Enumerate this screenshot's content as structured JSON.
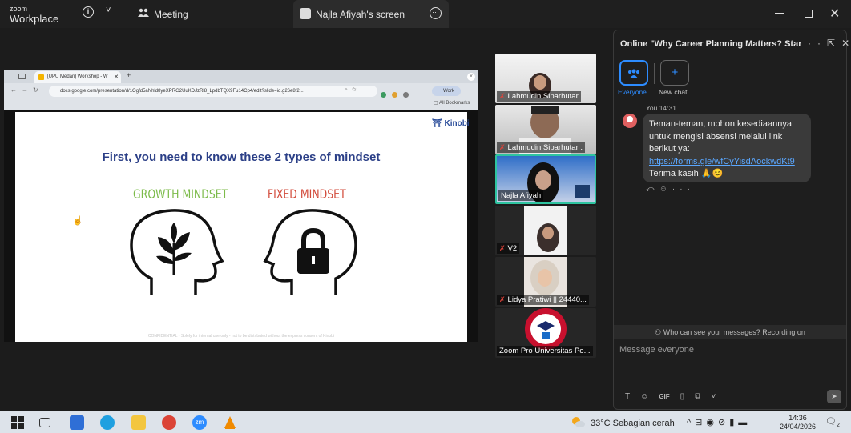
{
  "app": {
    "logo_line1": "zoom",
    "logo_line2": "Workplace",
    "info_icon": "info-icon",
    "chevron": "˅"
  },
  "toolbar": {
    "meeting_label": "Meeting",
    "share_label": "Najla Afiyah's screen"
  },
  "browser": {
    "tab_title": "[UPU Medan] Workshop - W",
    "url": "docs.google.com/presentation/d/1Ogfd5aNhld8yeXPRG2UuKDJzRl8_LpdbTQX9Fu14Cp4/edit?slide=id.g26e8f2...",
    "profile_label": "Work",
    "bookmarks_label": "All Bookmarks"
  },
  "slide": {
    "brand": "Kinobi",
    "title": "First, you need to know these 2 types of mindset",
    "growth_label": "GROWTH MINDSET",
    "fixed_label": "FIXED MINDSET",
    "footer": "CONFIDENTIAL - Solely for internal use only - not to be distributed without the express consent of Kinobi"
  },
  "gallery": {
    "tiles": [
      {
        "name": "Lahmudin Siparhutar",
        "muted": true
      },
      {
        "name": "Lahmudin Siparhutar .",
        "muted": true
      },
      {
        "name": "Najla Afiyah",
        "muted": false
      },
      {
        "name": "V2",
        "muted": true
      },
      {
        "name": "Lidya Pratiwi || 24440...",
        "muted": true
      },
      {
        "name": "Zoom Pro Universitas Po...",
        "muted": false
      }
    ]
  },
  "chat": {
    "title": "Online \"Why Career Planning Matters? Star...",
    "targets": [
      {
        "label": "Everyone"
      },
      {
        "label": "New chat"
      }
    ],
    "message": {
      "sender_meta": "You 14:31",
      "lines": [
        "Teman-teman, mohon kesediaannya",
        "untuk mengisi absensi melalui link",
        "berikut ya:"
      ],
      "link": "https://forms.gle/wfCyYisdAockwdKt9",
      "closing": "Terima kasih 🙏😊"
    },
    "visibility_notice": "Who can see your messages? Recording on",
    "compose_placeholder": "Message everyone",
    "gif_label": "GIF"
  },
  "taskbar": {
    "weather": "33°C  Sebagian cerah",
    "time": "14:36",
    "date": "24/04/2026",
    "notification_count": "2"
  },
  "colors": {
    "accent": "#2d8cff",
    "active_tile": "#2ec4a0",
    "growth": "#7cbb4a",
    "fixed": "#d24a3a",
    "slide_title": "#2b3f87"
  }
}
